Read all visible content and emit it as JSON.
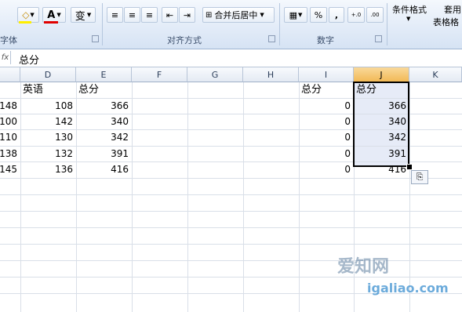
{
  "ribbon": {
    "font_group_fragment": "字体",
    "fill_color_icon": "fill-color-icon",
    "font_color_label": "A",
    "phonetic_label": "变",
    "alignment_group": "对齐方式",
    "merge_center": "合并后居中",
    "number_group": "数字",
    "percent": "%",
    "comma": ",",
    "decimal_inc": "←.0\n.00",
    "decimal_dec": ".00\n→.0",
    "cond_format": "条件格式",
    "table_style_top": "套用",
    "table_style_bottom": "表格格",
    "accent": "#d6e3f4"
  },
  "formula_bar": {
    "fx": "fx",
    "value": "总分"
  },
  "columns": [
    "D",
    "E",
    "F",
    "G",
    "H",
    "I",
    "J",
    "K"
  ],
  "selected_column": "J",
  "rows": [
    {
      "c": "",
      "d": "英语",
      "e": "总分",
      "i": "总分",
      "j": "总分"
    },
    {
      "c": "148",
      "d": "108",
      "e": "366",
      "i": "0",
      "j": "366"
    },
    {
      "c": "100",
      "d": "142",
      "e": "340",
      "i": "0",
      "j": "340"
    },
    {
      "c": "110",
      "d": "130",
      "e": "342",
      "i": "0",
      "j": "342"
    },
    {
      "c": "138",
      "d": "132",
      "e": "391",
      "i": "0",
      "j": "391"
    },
    {
      "c": "145",
      "d": "136",
      "e": "416",
      "i": "0",
      "j": "416"
    }
  ],
  "paste_icon": "clipboard-icon",
  "watermark": {
    "line1": "爱知网",
    "line2": "igaliao.com"
  }
}
